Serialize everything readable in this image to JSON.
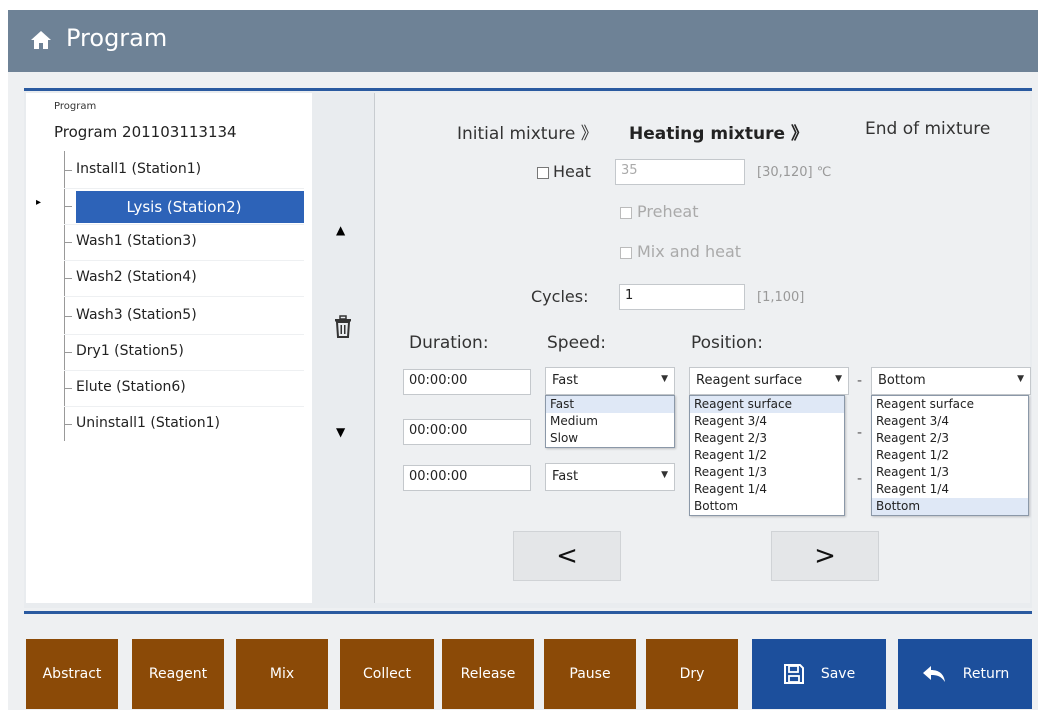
{
  "window": {
    "title": "Program",
    "icon": "home-icon"
  },
  "tree": {
    "root_label": "Program",
    "program_name": "Program 201103113134",
    "items": [
      {
        "label": "Install1 (Station1)",
        "selected": false
      },
      {
        "label": "Lysis (Station2)",
        "selected": true
      },
      {
        "label": "Wash1 (Station3)",
        "selected": false
      },
      {
        "label": "Wash2 (Station4)",
        "selected": false
      },
      {
        "label": "Wash3 (Station5)",
        "selected": false
      },
      {
        "label": "Dry1 (Station5)",
        "selected": false
      },
      {
        "label": "Elute (Station6)",
        "selected": false
      },
      {
        "label": "Uninstall1 (Station1)",
        "selected": false
      }
    ],
    "current_marker": "▸"
  },
  "side_controls": {
    "up": "▲",
    "down": "▼",
    "delete_icon": "trash-icon"
  },
  "steps": {
    "step1": "Initial mixture 》",
    "step2": "Heating mixture 》",
    "step3": "End of mixture"
  },
  "heat": {
    "label": "Heat",
    "value": "35",
    "range": "[30,120] ℃",
    "preheat_label": "Preheat",
    "mix_heat_label": "Mix and heat"
  },
  "cycles": {
    "label": "Cycles:",
    "value": "1",
    "range": "[1,100]"
  },
  "columns": {
    "duration": "Duration:",
    "speed": "Speed:",
    "position": "Position:"
  },
  "rows": [
    {
      "duration": "00:00:00",
      "speed": "Fast",
      "position_from": "Reagent surface",
      "position_to": "Bottom"
    },
    {
      "duration": "00:00:00"
    },
    {
      "duration": "00:00:00",
      "speed": "Fast"
    }
  ],
  "speed_options": [
    "Fast",
    "Medium",
    "Slow"
  ],
  "position_from_options": [
    "Reagent surface",
    "Reagent 3/4",
    "Reagent 2/3",
    "Reagent 1/2",
    "Reagent 1/3",
    "Reagent 1/4",
    "Bottom"
  ],
  "position_to_options": [
    "Reagent surface",
    "Reagent 3/4",
    "Reagent 2/3",
    "Reagent 1/2",
    "Reagent 1/3",
    "Reagent 1/4",
    "Bottom"
  ],
  "nav": {
    "prev": "<",
    "next": ">"
  },
  "toolbar": {
    "abstract": "Abstract",
    "reagent": "Reagent",
    "mix": "Mix",
    "collect": "Collect",
    "release": "Release",
    "pause": "Pause",
    "dry": "Dry",
    "save": "Save",
    "return": "Return"
  },
  "colors": {
    "brown_button": "#8b4a07",
    "blue_button": "#1c4f9c",
    "selection": "#2d63b8",
    "title_bar": "#6e8296"
  }
}
